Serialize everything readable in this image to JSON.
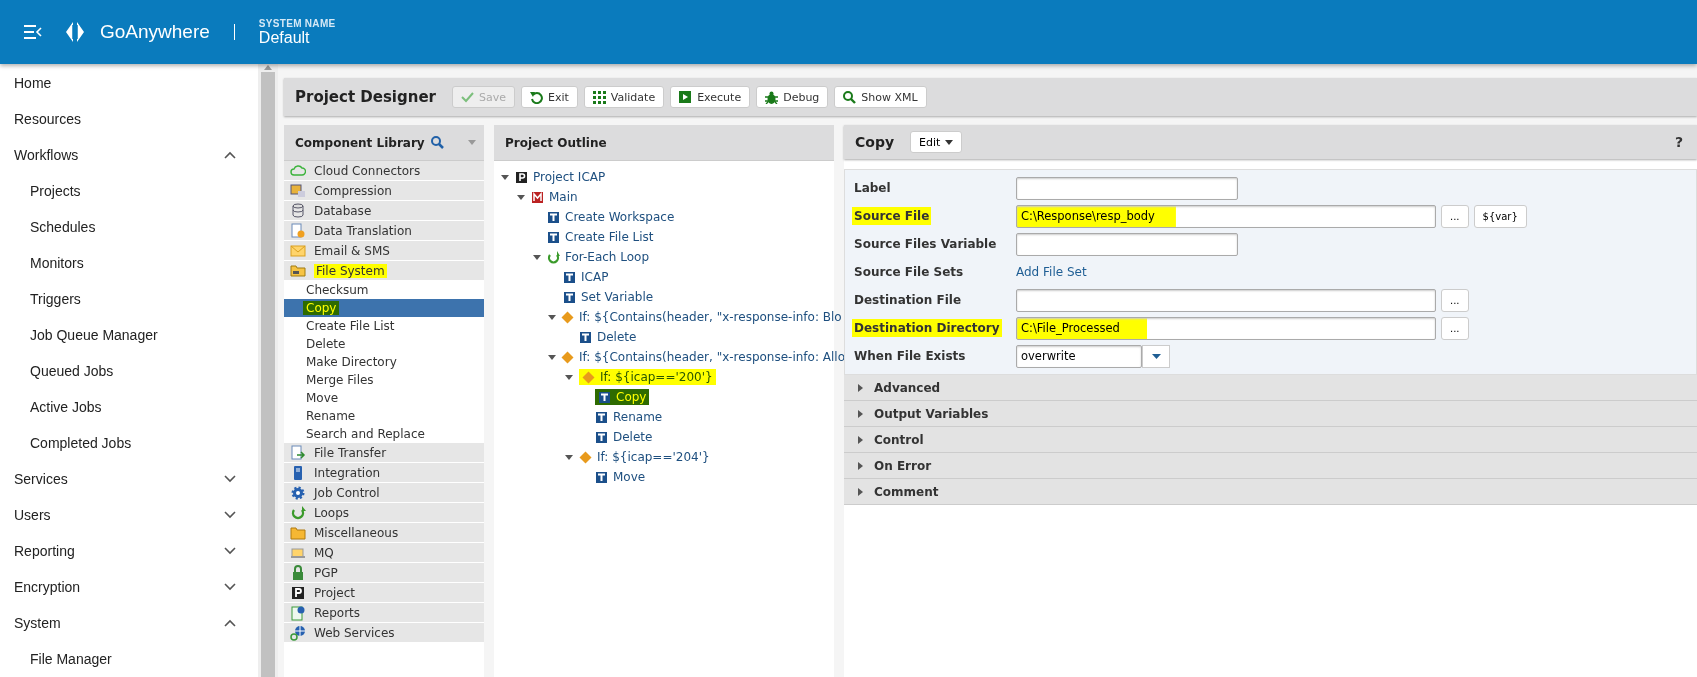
{
  "header": {
    "brand": "GoAnywhere",
    "system_label": "SYSTEM NAME",
    "system_name": "Default"
  },
  "sidebar": {
    "items": [
      {
        "label": "Home"
      },
      {
        "label": "Resources"
      },
      {
        "label": "Workflows",
        "expanded": true,
        "children": [
          {
            "label": "Projects"
          },
          {
            "label": "Schedules"
          },
          {
            "label": "Monitors"
          },
          {
            "label": "Triggers"
          },
          {
            "label": "Job Queue Manager"
          },
          {
            "label": "Queued Jobs"
          },
          {
            "label": "Active Jobs"
          },
          {
            "label": "Completed Jobs"
          }
        ]
      },
      {
        "label": "Services",
        "expanded": false
      },
      {
        "label": "Users",
        "expanded": false
      },
      {
        "label": "Reporting",
        "expanded": false
      },
      {
        "label": "Encryption",
        "expanded": false
      },
      {
        "label": "System",
        "expanded": true,
        "children": [
          {
            "label": "File Manager"
          }
        ]
      }
    ]
  },
  "designer": {
    "title": "Project Designer",
    "buttons": [
      {
        "label": "Save",
        "kind": "save",
        "disabled": true
      },
      {
        "label": "Exit",
        "kind": "exit",
        "disabled": false
      },
      {
        "label": "Validate",
        "kind": "validate",
        "disabled": false
      },
      {
        "label": "Execute",
        "kind": "execute",
        "disabled": false
      },
      {
        "label": "Debug",
        "kind": "debug",
        "disabled": false
      },
      {
        "label": "Show XML",
        "kind": "search",
        "disabled": false
      }
    ]
  },
  "library": {
    "title": "Component Library",
    "categories": [
      {
        "label": "Cloud Connectors",
        "kind": "cloud",
        "highlighted": false
      },
      {
        "label": "Compression",
        "kind": "compression",
        "highlighted": false
      },
      {
        "label": "Database",
        "kind": "database",
        "highlighted": false
      },
      {
        "label": "Data Translation",
        "kind": "translation",
        "highlighted": false
      },
      {
        "label": "Email & SMS",
        "kind": "email",
        "highlighted": false
      },
      {
        "label": "File System",
        "kind": "filesystem",
        "highlighted": true,
        "items": [
          {
            "label": "Checksum",
            "selected": false,
            "highlighted": false
          },
          {
            "label": "Copy",
            "selected": true,
            "highlighted": true
          },
          {
            "label": "Create File List",
            "selected": false,
            "highlighted": false
          },
          {
            "label": "Delete",
            "selected": false,
            "highlighted": false
          },
          {
            "label": "Make Directory",
            "selected": false,
            "highlighted": false
          },
          {
            "label": "Merge Files",
            "selected": false,
            "highlighted": false
          },
          {
            "label": "Move",
            "selected": false,
            "highlighted": false
          },
          {
            "label": "Rename",
            "selected": false,
            "highlighted": false
          },
          {
            "label": "Search and Replace",
            "selected": false,
            "highlighted": false
          }
        ]
      },
      {
        "label": "File Transfer",
        "kind": "transfer",
        "highlighted": false
      },
      {
        "label": "Integration",
        "kind": "integration",
        "highlighted": false
      },
      {
        "label": "Job Control",
        "kind": "gear",
        "highlighted": false
      },
      {
        "label": "Loops",
        "kind": "loop",
        "highlighted": false
      },
      {
        "label": "Miscellaneous",
        "kind": "folder",
        "highlighted": false
      },
      {
        "label": "MQ",
        "kind": "mq",
        "highlighted": false
      },
      {
        "label": "PGP",
        "kind": "lock",
        "highlighted": false
      },
      {
        "label": "Project",
        "kind": "project",
        "highlighted": false
      },
      {
        "label": "Reports",
        "kind": "reports",
        "highlighted": false
      },
      {
        "label": "Web Services",
        "kind": "web",
        "highlighted": false
      }
    ]
  },
  "outline": {
    "title": "Project Outline",
    "tree": [
      {
        "label": "Project ICAP",
        "kind": "project",
        "expanded": true,
        "highlighted": false,
        "children": [
          {
            "label": "Main",
            "kind": "module",
            "expanded": true,
            "highlighted": false,
            "children": [
              {
                "label": "Create Workspace",
                "kind": "task",
                "highlighted": false
              },
              {
                "label": "Create File List",
                "kind": "task",
                "highlighted": false
              },
              {
                "label": "For-Each Loop",
                "kind": "loop",
                "expanded": true,
                "highlighted": false,
                "children": [
                  {
                    "label": "ICAP",
                    "kind": "task",
                    "highlighted": false
                  },
                  {
                    "label": "Set Variable",
                    "kind": "task",
                    "highlighted": false
                  },
                  {
                    "label": "If: ${Contains(header, \"x-response-info: Blo",
                    "kind": "condition",
                    "expanded": true,
                    "highlighted": false,
                    "children": [
                      {
                        "label": "Delete",
                        "kind": "task",
                        "highlighted": false
                      }
                    ]
                  },
                  {
                    "label": "If: ${Contains(header, \"x-response-info: Allo",
                    "kind": "condition",
                    "expanded": true,
                    "highlighted": false,
                    "children": [
                      {
                        "label": "If: ${icap=='200'}",
                        "kind": "condition",
                        "expanded": true,
                        "highlighted": true,
                        "children": [
                          {
                            "label": "Copy",
                            "kind": "task",
                            "highlighted": true
                          },
                          {
                            "label": "Rename",
                            "kind": "task",
                            "highlighted": false
                          },
                          {
                            "label": "Delete",
                            "kind": "task",
                            "highlighted": false
                          }
                        ]
                      },
                      {
                        "label": "If: ${icap=='204'}",
                        "kind": "condition",
                        "expanded": true,
                        "highlighted": false,
                        "children": [
                          {
                            "label": "Move",
                            "kind": "task",
                            "highlighted": false
                          }
                        ]
                      }
                    ]
                  }
                ]
              }
            ]
          }
        ]
      }
    ]
  },
  "properties": {
    "title": "Copy",
    "edit_button": "Edit",
    "help": "?",
    "fields": [
      {
        "label": "Label",
        "kind": "text",
        "highlighted": false
      },
      {
        "label": "Source File",
        "kind": "text",
        "value": "C:\\Response\\resp_body",
        "highlighted": true,
        "browse": "...",
        "variable": "${var}"
      },
      {
        "label": "Source Files Variable",
        "kind": "text",
        "highlighted": false
      },
      {
        "label": "Source File Sets",
        "kind": "link",
        "value": "Add File Set",
        "highlighted": false
      },
      {
        "label": "Destination File",
        "kind": "text",
        "highlighted": false,
        "browse": "..."
      },
      {
        "label": "Destination Directory",
        "kind": "text",
        "value": "C:\\File_Processed",
        "highlighted": true,
        "browse": "..."
      },
      {
        "label": "When File Exists",
        "kind": "select",
        "value": "overwrite",
        "highlighted": false
      }
    ],
    "sections": [
      {
        "label": "Advanced",
        "expanded": false
      },
      {
        "label": "Output Variables",
        "expanded": false
      },
      {
        "label": "Control",
        "expanded": false
      },
      {
        "label": "On Error",
        "expanded": false
      },
      {
        "label": "Comment",
        "expanded": false
      }
    ]
  }
}
